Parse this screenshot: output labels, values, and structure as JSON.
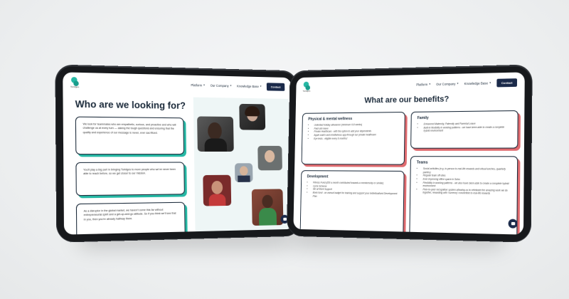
{
  "brand": {
    "name": "Toridges",
    "teal": "#26b8a4",
    "navy": "#1b2a4a",
    "coral": "#e06b6f"
  },
  "nav": {
    "items": [
      "Platform",
      "Our Company",
      "Knowledge Base"
    ],
    "contact": "Contact"
  },
  "left_page": {
    "title": "Who are we looking for?",
    "cards": [
      "We look for teammates who are empathetic, curious, and proactive and who will challenge us at every turn — asking the tough questions and ensuring that the quality and experience of our message is never, ever sacrificed.",
      "You'll play a big part in bringing Toridges to more people who we've never been able to reach before, so we get closer to our mission.",
      "As a disruptor in the global market, we haven't come this far without entrepreneurial spirit and a get-up-and-go attitude. So if you think we'll see that in you, then you're already halfway there."
    ]
  },
  "right_page": {
    "title": "What are our benefits?",
    "cards": [
      {
        "heading": "Physical & mental wellness",
        "items": [
          "Unlimited holiday allowance (minimum 6-8 weeks)",
          "Paid sick leave",
          "Private Healthcare - with the option to add your dependents",
          "Apple watch and mindfulness app through our private healthcare",
          "Eye tests - eligible every 6 months!"
        ]
      },
      {
        "heading": "Family",
        "items": [
          "Enhanced Maternity, Paternity and Parental Leave",
          "Built-in flexibility in working patterns - we have been able to create a complete hybrid environment"
        ]
      },
      {
        "heading": "Development",
        "items": [
          "Fitness Fund (£50 a month contributed towards a membership or similar)",
          "Cycle Scheme",
          "Ski at Work Support",
          "Book fund - an annual budget for training and support your individualised Development Plan"
        ]
      },
      {
        "heading": "Teams",
        "items": [
          "Social activities (e.g. in-person to real-life rewards and virtual lunches, quarterly parties)",
          "Regular team off-sites",
          "Ever improving office space in Soho",
          "Flexibility in working patterns - we also have been able to create a complete hybrid environment",
          "Peer-to-peer recognition system allowing us to celebrate the amazing work we do together, rewarding with 'currency' convertible to real-life rewards"
        ]
      }
    ]
  }
}
